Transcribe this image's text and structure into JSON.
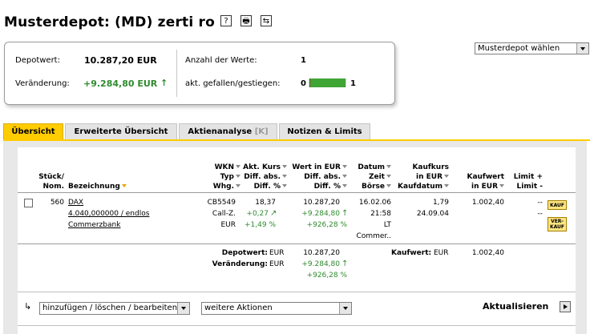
{
  "header": {
    "title": "Musterdepot: (MD) zerti ro",
    "icon_help": "?",
    "icon_print": "🖶",
    "icon_refresh": "⇆"
  },
  "depot_select": {
    "value": "Musterdepot wählen"
  },
  "summary": {
    "depotwert_label": "Depotwert:",
    "depotwert_value": "10.287,20 EUR",
    "veraenderung_label": "Veränderung:",
    "veraenderung_value": "+9.284,80 EUR",
    "anzahl_label": "Anzahl der Werte:",
    "anzahl_value": "1",
    "gefallen_label": "akt. gefallen/gestiegen:",
    "gefallen_value": "0",
    "gestiegen_value": "1",
    "gestiegen_fraction": 1.0
  },
  "tabs": [
    {
      "label": "Übersicht"
    },
    {
      "label": "Erweiterte Übersicht"
    },
    {
      "label": "Aktienanalyse"
    },
    {
      "label": "[K]"
    },
    {
      "label": "Notizen & Limits"
    }
  ],
  "table": {
    "headers": {
      "stueck1": "Stück/",
      "stueck2": "Nom.",
      "bezeichnung": "Bezeichnung",
      "wkn1": "WKN",
      "wkn2": "Typ",
      "wkn3": "Whg.",
      "kurs1": "Akt. Kurs",
      "kurs2": "Diff. abs.",
      "kurs3": "Diff. %",
      "wert1": "Wert in EUR",
      "wert2": "Diff. abs.",
      "wert3": "Diff. %",
      "datum1": "Datum",
      "datum2": "Zeit",
      "datum3": "Börse",
      "kk1": "Kaufkurs",
      "kk2": "in EUR",
      "kk3": "Kaufdatum",
      "kw1": "Kaufwert",
      "kw2": "in EUR",
      "limit1": "Limit +",
      "limit2": "Limit -"
    },
    "row": {
      "stueck": "560",
      "name": "DAX",
      "detail": "4.040,000000 / endlos",
      "emittent": "Commerzbank",
      "wkn": "CB5549",
      "typ": "Call-Z.",
      "whg": "EUR",
      "kurs": "18,37",
      "kurs_diff": "+0,27",
      "kurs_pct": "+1,49 %",
      "wert": "10.287,20",
      "wert_diff": "+9.284,80",
      "wert_pct": "+926,28 %",
      "datum": "16.02.06",
      "zeit": "21:58",
      "boerse1": "LT",
      "boerse2": "Commer..",
      "kaufkurs": "1,79",
      "kaufdatum": "24.09.04",
      "kaufwert": "1.002,40",
      "limit_plus": "--",
      "limit_minus": "--",
      "btn_kauf": "KAUF",
      "btn_verkauf1": "VER-",
      "btn_verkauf2": "KAUF"
    },
    "totals": {
      "depotwert_label": "Depotwert:",
      "depotwert_cur": "EUR",
      "depotwert_value": "10.287,20",
      "veraenderung_label": "Veränderung:",
      "veraenderung_cur": "EUR",
      "veraenderung_value": "+9.284,80",
      "veraenderung_pct": "+926,28 %",
      "kaufwert_label": "Kaufwert:",
      "kaufwert_cur": "EUR",
      "kaufwert_value": "1.002,40"
    }
  },
  "actions": {
    "select1": "hinzufügen / löschen / bearbeiten",
    "select2": "weitere Aktionen",
    "aktualisieren": "Aktualisieren"
  },
  "colors": {
    "accent": "#ffcc00",
    "positive": "#2f8a2f"
  }
}
